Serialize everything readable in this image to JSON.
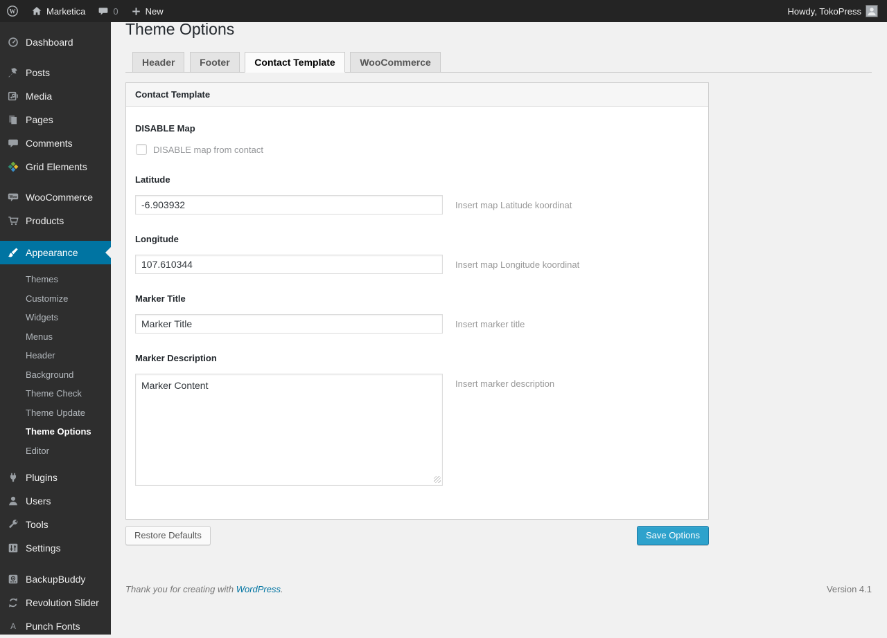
{
  "colors": {
    "adminbar_bg": "#242424",
    "sidebar_bg": "#2e2e2e",
    "highlight": "#0074a2",
    "primary_button": "#2ea2cc",
    "link": "#0074a2"
  },
  "admin_bar": {
    "site_name": "Marketica",
    "comment_count": "0",
    "new_label": "New",
    "howdy": "Howdy, TokoPress"
  },
  "sidebar": {
    "items": [
      {
        "label": "Dashboard",
        "icon": "dashboard-icon"
      },
      {
        "label": "Posts",
        "icon": "pin-icon"
      },
      {
        "label": "Media",
        "icon": "media-icon"
      },
      {
        "label": "Pages",
        "icon": "pages-icon"
      },
      {
        "label": "Comments",
        "icon": "comments-icon"
      },
      {
        "label": "Grid Elements",
        "icon": "grid-elements-icon"
      },
      {
        "label": "WooCommerce",
        "icon": "woocommerce-icon"
      },
      {
        "label": "Products",
        "icon": "cart-icon"
      },
      {
        "label": "Appearance",
        "icon": "brush-icon",
        "active": true
      },
      {
        "label": "Plugins",
        "icon": "plugin-icon"
      },
      {
        "label": "Users",
        "icon": "user-icon"
      },
      {
        "label": "Tools",
        "icon": "wrench-icon"
      },
      {
        "label": "Settings",
        "icon": "settings-icon"
      },
      {
        "label": "BackupBuddy",
        "icon": "backup-icon"
      },
      {
        "label": "Revolution Slider",
        "icon": "revolution-icon"
      },
      {
        "label": "Punch Fonts",
        "icon": "fonts-icon"
      }
    ],
    "appearance_submenu": [
      "Themes",
      "Customize",
      "Widgets",
      "Menus",
      "Header",
      "Background",
      "Theme Check",
      "Theme Update",
      "Theme Options",
      "Editor"
    ],
    "current_submenu": "Theme Options"
  },
  "main": {
    "page_title": "Theme Options",
    "tabs": [
      {
        "label": "Header",
        "active": false
      },
      {
        "label": "Footer",
        "active": false
      },
      {
        "label": "Contact Template",
        "active": true
      },
      {
        "label": "WooCommerce",
        "active": false
      }
    ],
    "panel": {
      "title": "Contact Template",
      "fields": [
        {
          "type": "checkbox",
          "label": "DISABLE Map",
          "checkbox_label": "DISABLE map from contact",
          "checked": false
        },
        {
          "type": "text",
          "label": "Latitude",
          "value": "-6.903932",
          "help": "Insert map Latitude koordinat"
        },
        {
          "type": "text",
          "label": "Longitude",
          "value": "107.610344",
          "help": "Insert map Longitude koordinat"
        },
        {
          "type": "text",
          "label": "Marker Title",
          "value": "Marker Title",
          "help": "Insert marker title"
        },
        {
          "type": "textarea",
          "label": "Marker Description",
          "value": "Marker Content",
          "help": "Insert marker description"
        }
      ]
    },
    "actions": {
      "restore": "Restore Defaults",
      "save": "Save Options"
    }
  },
  "footer": {
    "thanks_prefix": "Thank you for creating with",
    "link_text": "WordPress",
    "thanks_suffix": ".",
    "version": "Version 4.1"
  }
}
